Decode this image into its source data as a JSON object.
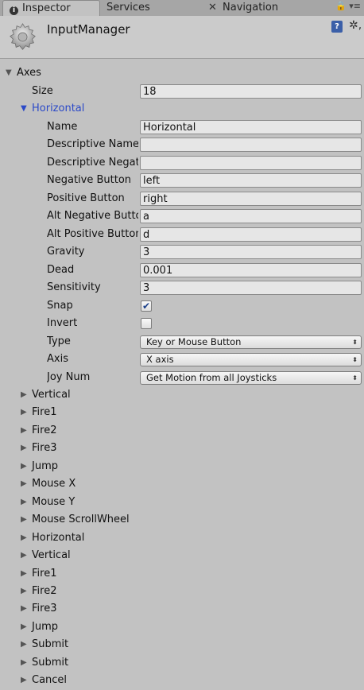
{
  "tabs": {
    "inspector": "Inspector",
    "services": "Services",
    "navigation": "Navigation",
    "tools": "🔒 ▾≡"
  },
  "header": {
    "title": "InputManager",
    "help_glyph": "?",
    "settings_glyph": "✲,"
  },
  "axes": {
    "label": "Axes",
    "size_label": "Size",
    "size_value": "18",
    "expanded_label": "Horizontal",
    "fields": {
      "name_label": "Name",
      "name_value": "Horizontal",
      "desc_name_label": "Descriptive Name",
      "desc_name_value": "",
      "desc_neg_label": "Descriptive Negative Name",
      "desc_neg_value": "",
      "neg_button_label": "Negative Button",
      "neg_button_value": "left",
      "pos_button_label": "Positive Button",
      "pos_button_value": "right",
      "alt_neg_label": "Alt Negative Button",
      "alt_neg_value": "a",
      "alt_pos_label": "Alt Positive Button",
      "alt_pos_value": "d",
      "gravity_label": "Gravity",
      "gravity_value": "3",
      "dead_label": "Dead",
      "dead_value": "0.001",
      "sensitivity_label": "Sensitivity",
      "sensitivity_value": "3",
      "snap_label": "Snap",
      "snap_checked": true,
      "invert_label": "Invert",
      "invert_checked": false,
      "type_label": "Type",
      "type_value": "Key or Mouse Button",
      "axis_label": "Axis",
      "axis_value": "X axis",
      "joy_label": "Joy Num",
      "joy_value": "Get Motion from all Joysticks"
    },
    "collapsed_items": [
      "Vertical",
      "Fire1",
      "Fire2",
      "Fire3",
      "Jump",
      "Mouse X",
      "Mouse Y",
      "Mouse ScrollWheel",
      "Horizontal",
      "Vertical",
      "Fire1",
      "Fire2",
      "Fire3",
      "Jump",
      "Submit",
      "Submit",
      "Cancel"
    ]
  }
}
